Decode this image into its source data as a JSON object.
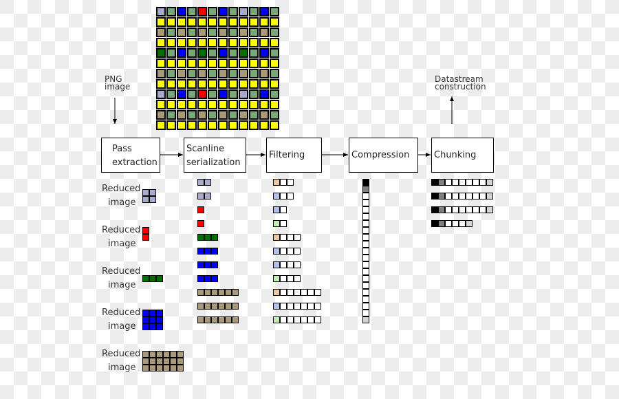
{
  "palette": {
    "L": "#aaaacc",
    "G": "#78a878",
    "B": "#0000ff",
    "R": "#ff0000",
    "T": "#a89a78",
    "Y": "#ffff00",
    "D": "#007000",
    "P": "#f0c8a0",
    "C": "#b0c0f0",
    "E": "#c0f0b0",
    "W": "#ffffff",
    "K": "#000000",
    "M": "#808080",
    "S": "#d4d4d4"
  },
  "input_label": "PNG image",
  "output_label": "Datastream construction",
  "steps": [
    {
      "label": "Pass extraction"
    },
    {
      "label": "Scanline serialization"
    },
    {
      "label": "Filtering"
    },
    {
      "label": "Compression"
    },
    {
      "label": "Chunking"
    }
  ],
  "image_grid": [
    "LGBGRGBGLGBG",
    "YYYYYYYYYYYY",
    "TGTGTGTGTGTG",
    "YYYYYYYYYYYY",
    "DGBGDGBGDGBG",
    "YYYYYYYYYYYY",
    "TGTGTGTGTGTG",
    "YYYYYYYYYYYY",
    "LGBGRGBGLGBG",
    "YYYYYYYYYYYY",
    "TGTGTGTGTGTG",
    "YYYYYYYYYYYY"
  ],
  "reduced_label_1": "Reduced",
  "reduced_label_2": "image",
  "reduced_images": [
    [
      "LL",
      "LL"
    ],
    [
      "R",
      "R"
    ],
    [
      "DDD"
    ],
    [
      "BBB",
      "BBB",
      "BBB"
    ],
    [
      "TTTTTT",
      "TTTTTT",
      "TTTTTT"
    ]
  ],
  "scanlines": [
    "LL",
    "LL",
    "R",
    "R",
    "DDD",
    "BBB",
    "BBB",
    "BBB",
    "TTTTTT",
    "TTTTTT",
    "TTTTTT"
  ],
  "filtered": [
    "PWW",
    "CWW",
    "CW",
    "EW",
    "PWWW",
    "CWWW",
    "CWWW",
    "EWWW",
    "PWWWWWW",
    "CWWWWWW",
    "EWWWWWW"
  ],
  "compressed": "KMWWWWWWWWWWWWWWWWWWS",
  "chunks": [
    "KMWWWWWWS",
    "KMWWWWWWS",
    "KMWWWWWWS",
    "KMWWWS"
  ]
}
